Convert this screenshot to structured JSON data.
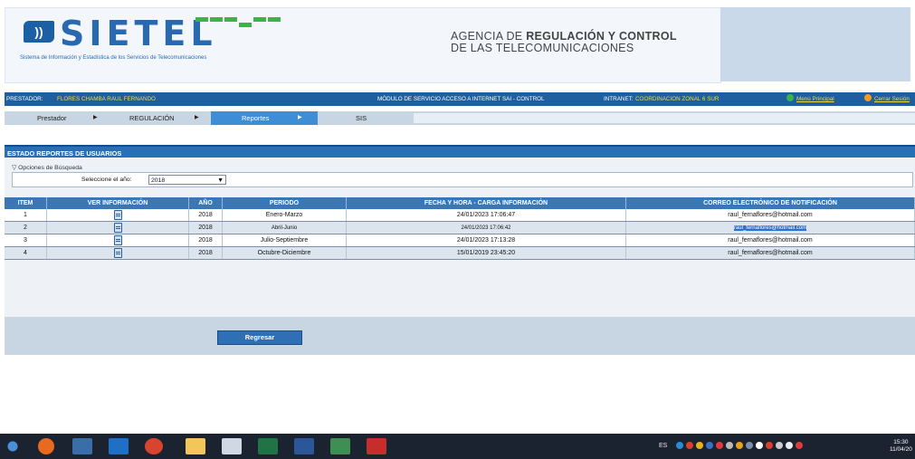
{
  "header": {
    "logo_mark": "))",
    "logo_text": "SIETEL",
    "logo_subtitle": "Sistema de Información y Estadística de los Servicios de Telecomunicaciones",
    "agency_line1_part1": "AGENCIA DE ",
    "agency_line1_part2": "REGULACIÓN Y CONTROL",
    "agency_line2": "DE LAS TELECOMUNICACIONES"
  },
  "infobar": {
    "prestador_label": "PRESTADOR:",
    "prestador_value": "FLORES CHAMBA RAUL FERNANDO",
    "module": "MÓDULO DE SERVICIO ACCESO A INTERNET SAI - CONTROL",
    "intranet_label": "INTRANET:",
    "intranet_value": "COORDINACION ZONAL 6 SUR",
    "menu_label": "Menú Principal",
    "logout_label": "Cerrar Sesión"
  },
  "nav": {
    "tabs": [
      {
        "label": "Prestador"
      },
      {
        "label": "REGULACIÓN"
      },
      {
        "label": "Reportes"
      },
      {
        "label": "SIS"
      }
    ],
    "arrow": "▶"
  },
  "panel": {
    "title": "ESTADO REPORTES DE USUARIOS",
    "search_legend": "Opciones de Búsqueda",
    "year_label": "Seleccione el año:",
    "year_value": "2018"
  },
  "table": {
    "headers": [
      "ITEM",
      "VER INFORMACIÓN",
      "AÑO",
      "PERIODO",
      "FECHA Y HORA - CARGA INFORMACIÓN",
      "CORREO ELECTRÓNICO DE NOTIFICACIÓN"
    ],
    "rows": [
      {
        "item": "1",
        "year": "2018",
        "period": "Enero-Marzo",
        "datetime": "24/01/2023 17:06:47",
        "email": "raul_fernaflores@hotmail.com"
      },
      {
        "item": "2",
        "year": "2018",
        "period": "Abril-Junio",
        "datetime": "24/01/2023 17:06:42",
        "email": "raul_fernaflores@hotmail.com"
      },
      {
        "item": "3",
        "year": "2018",
        "period": "Julio-Septiembre",
        "datetime": "24/01/2023 17:13:28",
        "email": "raul_fernaflores@hotmail.com"
      },
      {
        "item": "4",
        "year": "2018",
        "period": "Octubre-Diciembre",
        "datetime": "15/01/2019 23:45:20",
        "email": "raul_fernaflores@hotmail.com"
      }
    ]
  },
  "buttons": {
    "back": "Regresar"
  },
  "taskbar": {
    "lang": "ES",
    "time": "15:30",
    "date": "11/04/20"
  }
}
